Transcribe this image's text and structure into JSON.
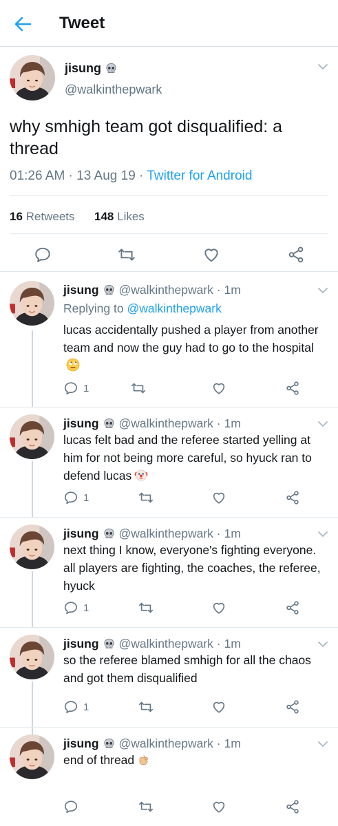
{
  "header": {
    "title": "Tweet",
    "back_icon": "back-arrow-icon"
  },
  "author": {
    "name": "jisung",
    "handle": "@walkinthepwark",
    "badge_icon": "skull-emoji"
  },
  "tweet": {
    "text": "why smhigh team got disqualified: a thread",
    "time": "01:26 AM",
    "date": "13 Aug 19",
    "source": "Twitter for Android",
    "retweets_count": "16",
    "retweets_label": "Retweets",
    "likes_count": "148",
    "likes_label": "Likes"
  },
  "replies": [
    {
      "name": "jisung",
      "handle": "@walkinthepwark · 1m",
      "replying_prefix": "Replying to",
      "replying_to": "@walkinthepwark",
      "text": "lucas accidentally pushed a player from another team and now the guy had to go to the hospital",
      "emoji": "eye-roll-emoji",
      "reply_count": "1"
    },
    {
      "name": "jisung",
      "handle": "@walkinthepwark · 1m",
      "text": "lucas felt bad and the referee started yelling at him for not being more careful, so hyuck ran to defend lucas",
      "emoji": "clown-emoji",
      "reply_count": "1"
    },
    {
      "name": "jisung",
      "handle": "@walkinthepwark · 1m",
      "text": "next thing I know, everyone's fighting everyone. all players are fighting, the coaches, the referee, hyuck",
      "reply_count": "1"
    },
    {
      "name": "jisung",
      "handle": "@walkinthepwark · 1m",
      "text": "so the referee blamed smhigh for all the chaos and got them disqualified",
      "reply_count": "1"
    },
    {
      "name": "jisung",
      "handle": "@walkinthepwark · 1m",
      "text": "end of thread",
      "emoji": "pointing-hand-emoji",
      "reply_count": ""
    }
  ],
  "colors": {
    "accent": "#1da1f2",
    "muted": "#657786",
    "text": "#14171a",
    "divider": "#e1e8ed"
  }
}
